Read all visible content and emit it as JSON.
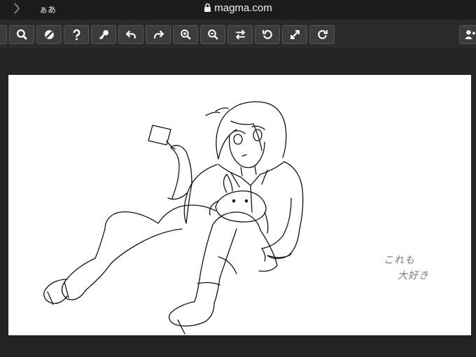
{
  "browser": {
    "reader_label": "ぁあ",
    "url": "magma.com"
  },
  "toolbar": {
    "buttons": [
      {
        "name": "menu-button",
        "icon": "menu-icon"
      },
      {
        "name": "search-button",
        "icon": "magnifier-icon"
      },
      {
        "name": "color-button",
        "icon": "contrast-icon"
      },
      {
        "name": "help-button",
        "icon": "question-icon"
      },
      {
        "name": "key-button",
        "icon": "key-icon"
      },
      {
        "name": "undo-button",
        "icon": "undo-icon"
      },
      {
        "name": "redo-button",
        "icon": "redo-icon"
      },
      {
        "name": "zoom-in-button",
        "icon": "zoom-in-icon"
      },
      {
        "name": "zoom-out-button",
        "icon": "zoom-out-icon"
      },
      {
        "name": "flip-button",
        "icon": "swap-icon"
      },
      {
        "name": "rotate-left-button",
        "icon": "rotate-left-icon"
      },
      {
        "name": "fullscreen-button",
        "icon": "expand-icon"
      },
      {
        "name": "rotate-right-button",
        "icon": "rotate-right-icon"
      },
      {
        "name": "add-user-button",
        "icon": "add-user-icon"
      }
    ]
  },
  "canvas": {
    "signature_line1": "これも",
    "signature_line2": "大好き"
  }
}
